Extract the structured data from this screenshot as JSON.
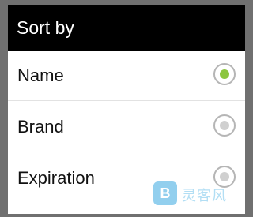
{
  "dialog": {
    "title": "Sort by",
    "options": [
      {
        "label": "Name",
        "selected": true
      },
      {
        "label": "Brand",
        "selected": false
      },
      {
        "label": "Expiration",
        "selected": false
      }
    ]
  },
  "colors": {
    "title_bar": "#000000",
    "radio_selected": "#8cc63f",
    "radio_unselected": "#d0d0d0"
  },
  "watermark": {
    "icon_letter": "B",
    "text": "灵客风"
  }
}
